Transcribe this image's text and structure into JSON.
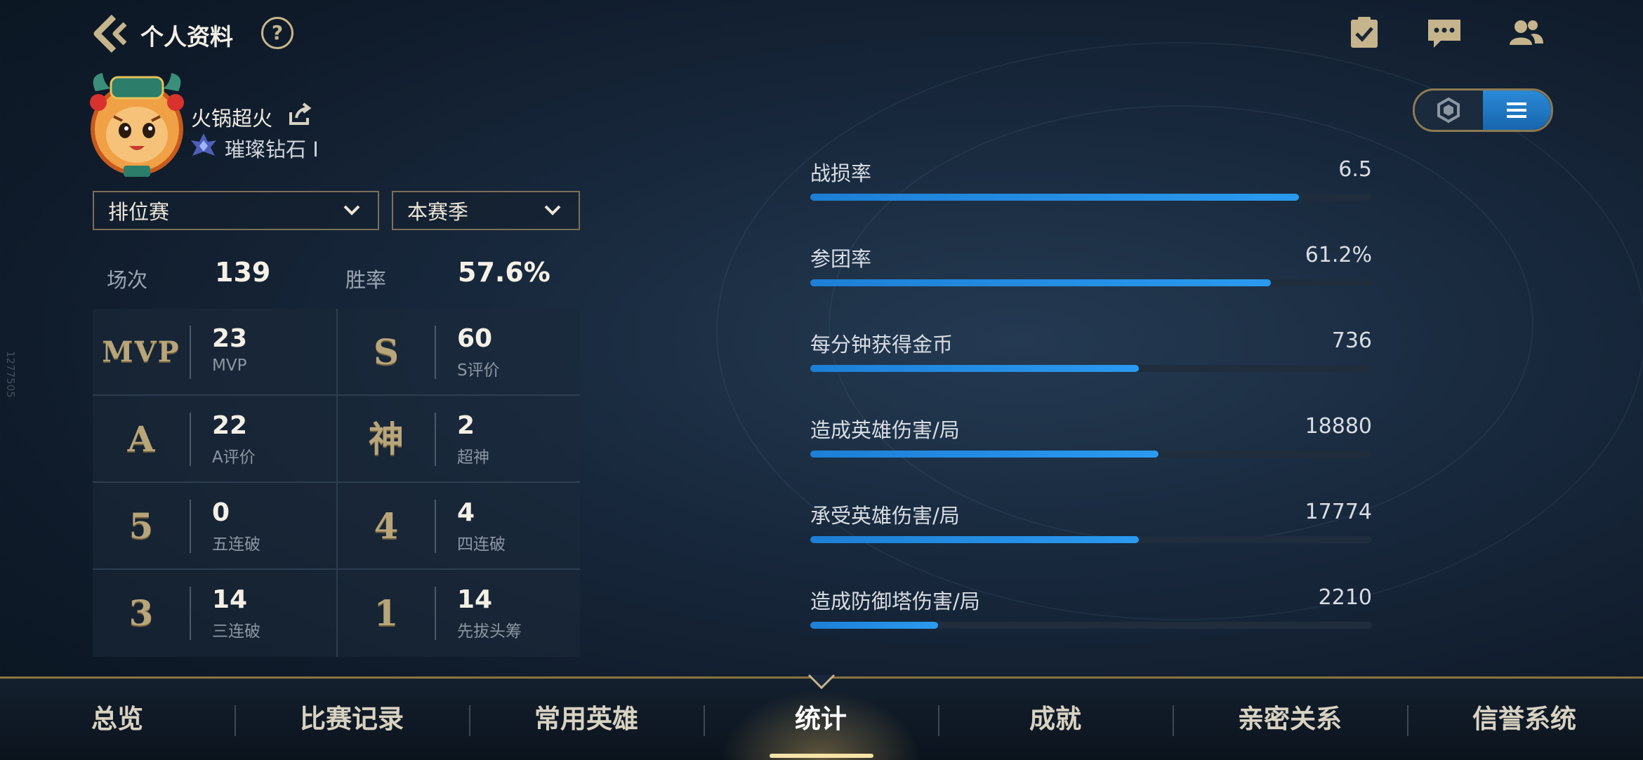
{
  "side_id": "1277505",
  "header": {
    "title": "个人资料",
    "help_label": "?"
  },
  "profile": {
    "name": "火锅超火",
    "rank": "璀璨钻石 Ⅰ"
  },
  "filters": {
    "mode": "排位赛",
    "season": "本赛季"
  },
  "summary": {
    "games_label": "场次",
    "games_value": "139",
    "winrate_label": "胜率",
    "winrate_value": "57.6%"
  },
  "stats_grid": [
    {
      "badge": "MVP",
      "value": "23",
      "caption": "MVP"
    },
    {
      "badge": "S",
      "value": "60",
      "caption": "S评价"
    },
    {
      "badge": "A",
      "value": "22",
      "caption": "A评价"
    },
    {
      "badge": "神",
      "value": "2",
      "caption": "超神"
    },
    {
      "badge": "5",
      "value": "0",
      "caption": "五连破"
    },
    {
      "badge": "4",
      "value": "4",
      "caption": "四连破"
    },
    {
      "badge": "3",
      "value": "14",
      "caption": "三连破"
    },
    {
      "badge": "1",
      "value": "14",
      "caption": "先拔头筹"
    }
  ],
  "metrics": [
    {
      "label": "战损率",
      "value": "6.5",
      "fill": 0.87
    },
    {
      "label": "参团率",
      "value": "61.2%",
      "fill": 0.82
    },
    {
      "label": "每分钟获得金币",
      "value": "736",
      "fill": 0.585
    },
    {
      "label": "造成英雄伤害/局",
      "value": "18880",
      "fill": 0.62
    },
    {
      "label": "承受英雄伤害/局",
      "value": "17774",
      "fill": 0.585
    },
    {
      "label": "造成防御塔伤害/局",
      "value": "2210",
      "fill": 0.228
    }
  ],
  "tabs": [
    "总览",
    "比赛记录",
    "常用英雄",
    "统计",
    "成就",
    "亲密关系",
    "信誉系统"
  ],
  "active_tab": "统计",
  "icons": {
    "back": "back-arrow-icon",
    "help": "help-icon",
    "tasks": "clipboard-check-icon",
    "chat": "chat-icon",
    "friends": "friends-icon",
    "share": "share-icon",
    "rank": "rank-diamond-icon",
    "view_hex": "hexagon-view-icon",
    "view_list": "list-view-icon"
  },
  "colors": {
    "accent_gold": "#c6b58c",
    "bar_blue": "#1d7fd6",
    "background": "#18283c"
  }
}
